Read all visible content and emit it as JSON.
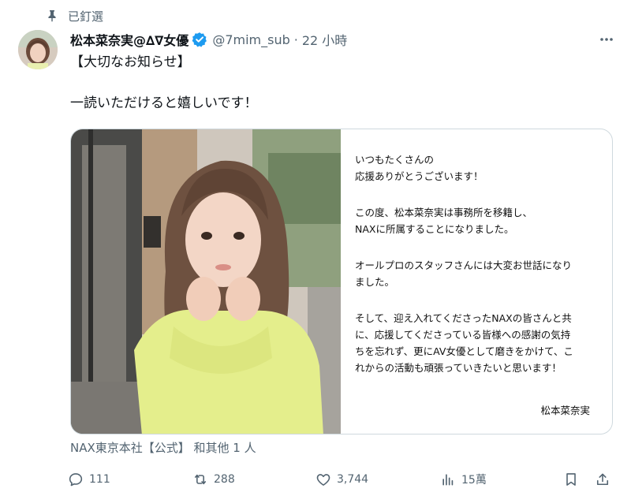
{
  "pinned": {
    "label": "已釘選"
  },
  "author": {
    "display_name": "松本菜奈実@∆∇女優",
    "handle": "@7mim_sub",
    "separator": "·",
    "time": "22 小時"
  },
  "tweet": {
    "line1": "【大切なお知らせ】",
    "line2": "一読いただけると嬉しいです！"
  },
  "notice": {
    "p1": "いつもたくさんの\n応援ありがとうございます！",
    "p2": "この度、松本菜奈実は事務所を移籍し、\nNAXに所属することになりました。",
    "p3": "オールプロのスタッフさんには大変お世話になり\nました。",
    "p4": "そして、迎え入れてくださったNAXの皆さんと共\nに、応援してくださっている皆様への感謝の気持\nちを忘れず、更にAV女優として磨きをかけて、こ\nれからの活動も頑張っていきたいと思います！",
    "signature": "松本菜奈実"
  },
  "retweeted_by": "NAX東京本社【公式】 和其他 1 人",
  "actions": {
    "replies": "111",
    "retweets": "288",
    "likes": "3,744",
    "views": "15萬"
  },
  "colors": {
    "text": "#0f1419",
    "muted": "#536471",
    "verified": "#1d9bf0",
    "border": "#cfd9de",
    "sweater": "#e4ee8c"
  }
}
